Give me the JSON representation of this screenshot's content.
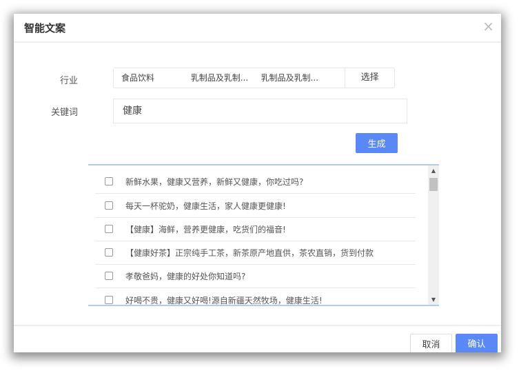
{
  "dialog": {
    "title": "智能文案",
    "close_icon": "×"
  },
  "industry": {
    "label": "行业",
    "values": [
      "食品饮料",
      "乳制品及乳制...",
      "乳制品及乳制..."
    ],
    "select_label": "选择"
  },
  "keyword": {
    "label": "关键词",
    "value": "健康"
  },
  "generate_label": "生成",
  "results": [
    "新鲜水果，健康又营养，新鲜又健康，你吃过吗?",
    "每天一杯驼奶，健康生活，家人健康更健康!",
    "【健康】海鲜，营养更健康，吃货们的福音!",
    "【健康好茶】正宗纯手工茶，新茶原产地直供，茶农直销，货到付款",
    "孝敬爸妈，健康的好处你知道吗?",
    "好喝不贵，健康又好喝!源自新疆天然牧场，健康生活!"
  ],
  "footer": {
    "cancel_label": "取消",
    "confirm_label": "确认"
  },
  "colors": {
    "primary": "#5b88f7",
    "list_border": "#b0cdec"
  }
}
